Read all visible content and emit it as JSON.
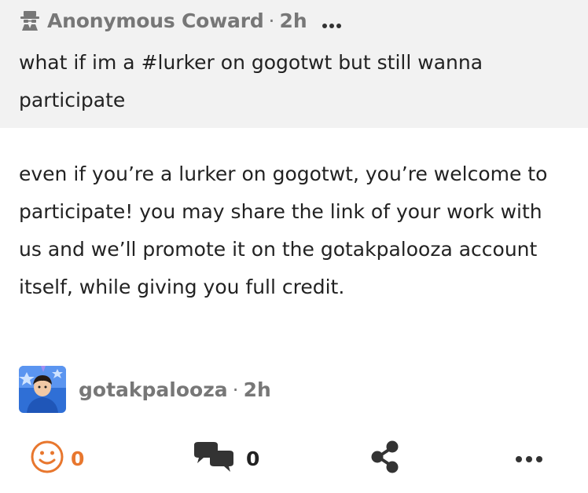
{
  "question": {
    "author": "Anonymous Coward",
    "separator": "·",
    "time": "2h",
    "text": "what if im a #lurker on gogotwt but still wanna participate"
  },
  "answer": {
    "text": "even if you’re a lurker on gogotwt, you’re welcome to participate! you may share the link of your work with us and we’ll promote it on the gotakpalooza account itself, while giving you full credit."
  },
  "responder": {
    "name": "gotakpalooza",
    "separator": "·",
    "time": "2h"
  },
  "actions": {
    "reactions_count": "0",
    "comments_count": "0"
  },
  "icons": {
    "anonymous": "spy-icon",
    "more": "ellipsis-icon",
    "react": "smiley-icon",
    "comment": "comments-icon",
    "share": "share-icon"
  },
  "colors": {
    "accent": "#e8772e",
    "muted": "#777777",
    "question_bg": "#f2f2f2",
    "text": "#222222"
  }
}
